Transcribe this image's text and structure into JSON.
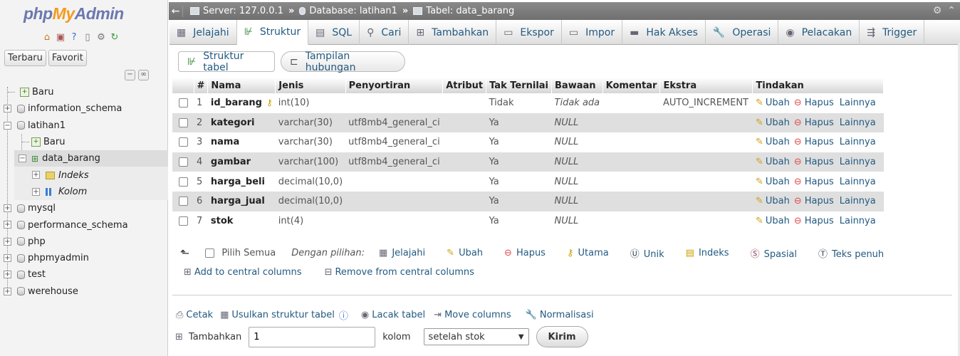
{
  "sidebar": {
    "logo": {
      "php": "php",
      "my": "My",
      "admin": "Admin"
    },
    "tabs": [
      "Terbaru",
      "Favorit"
    ],
    "tree": [
      {
        "label": "Baru",
        "icon": "new-icon"
      },
      {
        "label": "information_schema",
        "icon": "database-icon"
      },
      {
        "label": "latihan1",
        "icon": "database-icon"
      },
      {
        "label": "Baru",
        "icon": "new-icon"
      },
      {
        "label": "data_barang",
        "icon": "table-icon"
      },
      {
        "label": "Indeks",
        "icon": "index-icon"
      },
      {
        "label": "Kolom",
        "icon": "columns-icon"
      },
      {
        "label": "mysql",
        "icon": "database-icon"
      },
      {
        "label": "performance_schema",
        "icon": "database-icon"
      },
      {
        "label": "php",
        "icon": "database-icon"
      },
      {
        "label": "phpmyadmin",
        "icon": "database-icon"
      },
      {
        "label": "test",
        "icon": "database-icon"
      },
      {
        "label": "werehouse",
        "icon": "database-icon"
      }
    ]
  },
  "breadcrumb": {
    "server": "Server: 127.0.0.1",
    "database": "Database: latihan1",
    "table": "Tabel: data_barang",
    "separator": "»"
  },
  "tabs": [
    {
      "label": "Jelajahi",
      "icon": "browse-icon"
    },
    {
      "label": "Struktur",
      "icon": "structure-icon",
      "active": true
    },
    {
      "label": "SQL",
      "icon": "sql-icon"
    },
    {
      "label": "Cari",
      "icon": "search-icon"
    },
    {
      "label": "Tambahkan",
      "icon": "insert-icon"
    },
    {
      "label": "Ekspor",
      "icon": "export-icon"
    },
    {
      "label": "Impor",
      "icon": "import-icon"
    },
    {
      "label": "Hak Akses",
      "icon": "privileges-icon"
    },
    {
      "label": "Operasi",
      "icon": "operations-icon"
    },
    {
      "label": "Pelacakan",
      "icon": "tracking-icon"
    },
    {
      "label": "Trigger",
      "icon": "trigger-icon"
    }
  ],
  "subtabs": {
    "structure": "Struktur tabel",
    "relation": "Tampilan hubungan"
  },
  "table": {
    "headers": [
      "#",
      "Nama",
      "Jenis",
      "Penyortiran",
      "Atribut",
      "Tak Ternilai",
      "Bawaan",
      "Komentar",
      "Ekstra",
      "Tindakan"
    ],
    "rows": [
      {
        "num": "1",
        "name": "id_barang",
        "type": "int(10)",
        "collation": "",
        "attr": "",
        "null": "Tidak",
        "default": "Tidak ada",
        "comment": "",
        "extra": "AUTO_INCREMENT",
        "primary": true
      },
      {
        "num": "2",
        "name": "kategori",
        "type": "varchar(30)",
        "collation": "utf8mb4_general_ci",
        "attr": "",
        "null": "Ya",
        "default": "NULL",
        "comment": "",
        "extra": ""
      },
      {
        "num": "3",
        "name": "nama",
        "type": "varchar(30)",
        "collation": "utf8mb4_general_ci",
        "attr": "",
        "null": "Ya",
        "default": "NULL",
        "comment": "",
        "extra": ""
      },
      {
        "num": "4",
        "name": "gambar",
        "type": "varchar(100)",
        "collation": "utf8mb4_general_ci",
        "attr": "",
        "null": "Ya",
        "default": "NULL",
        "comment": "",
        "extra": ""
      },
      {
        "num": "5",
        "name": "harga_beli",
        "type": "decimal(10,0)",
        "collation": "",
        "attr": "",
        "null": "Ya",
        "default": "NULL",
        "comment": "",
        "extra": ""
      },
      {
        "num": "6",
        "name": "harga_jual",
        "type": "decimal(10,0)",
        "collation": "",
        "attr": "",
        "null": "Ya",
        "default": "NULL",
        "comment": "",
        "extra": ""
      },
      {
        "num": "7",
        "name": "stok",
        "type": "int(4)",
        "collation": "",
        "attr": "",
        "null": "Ya",
        "default": "NULL",
        "comment": "",
        "extra": ""
      }
    ],
    "actions": {
      "edit": "Ubah",
      "delete": "Hapus",
      "more": "Lainnya"
    }
  },
  "bulk": {
    "select_all": "Pilih Semua",
    "with_selected": "Dengan pilihan:",
    "items": [
      "Jelajahi",
      "Ubah",
      "Hapus",
      "Utama",
      "Unik",
      "Indeks",
      "Spasial",
      "Teks penuh"
    ],
    "add_central": "Add to central columns",
    "remove_central": "Remove from central columns"
  },
  "links": {
    "print": "Cetak",
    "propose": "Usulkan struktur tabel",
    "track": "Lacak tabel",
    "move": "Move columns",
    "normalize": "Normalisasi"
  },
  "add_columns": {
    "label": "Tambahkan",
    "count": "1",
    "unit": "kolom",
    "position": "setelah stok",
    "submit": "Kirim"
  }
}
